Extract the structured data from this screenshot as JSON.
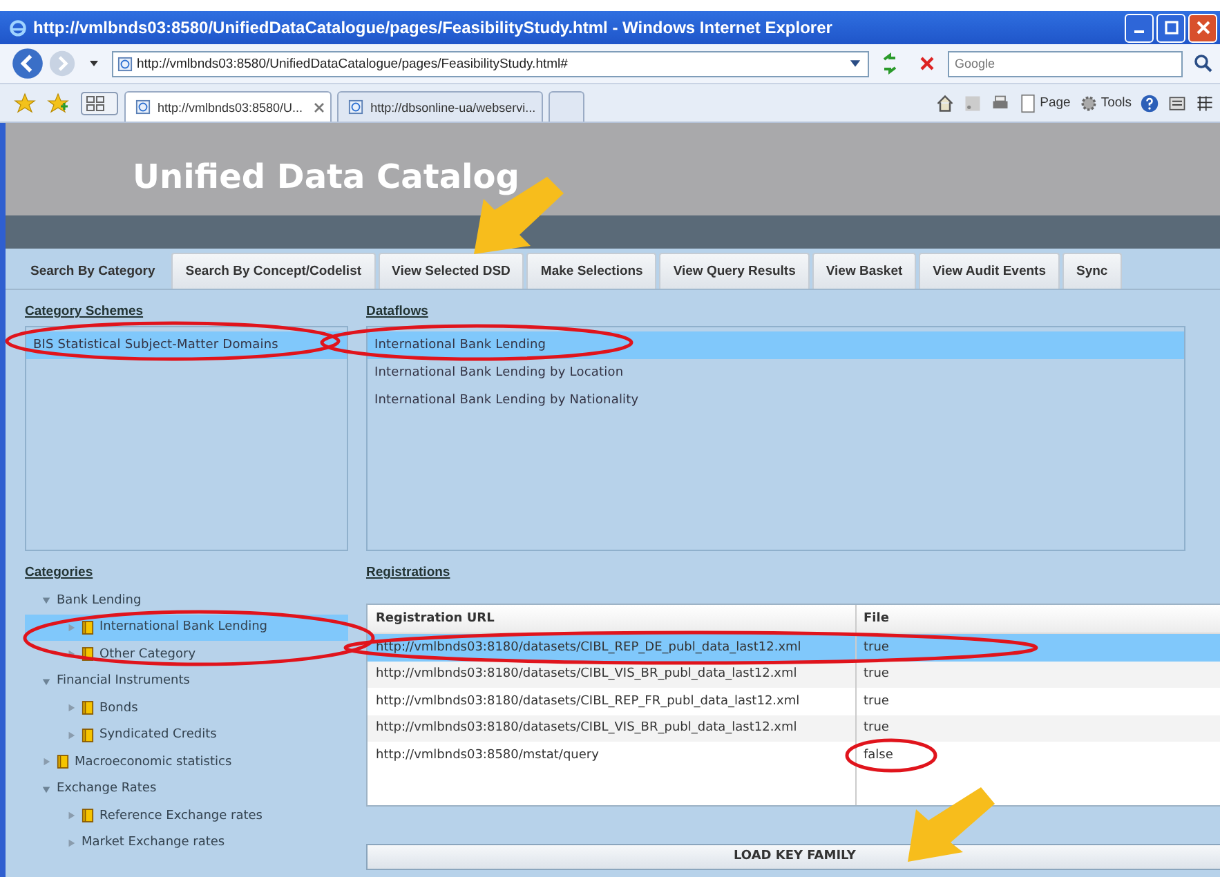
{
  "window": {
    "title": "http://vmlbnds03:8580/UnifiedDataCatalogue/pages/FeasibilityStudy.html - Windows Internet Explorer"
  },
  "address_bar": {
    "value": "http://vmlbnds03:8580/UnifiedDataCatalogue/pages/FeasibilityStudy.html#"
  },
  "search": {
    "placeholder": "Google"
  },
  "browser_tabs": [
    {
      "label": "http://vmlbnds03:8580/U...",
      "selected": true
    },
    {
      "label": "http://dbsonline-ua/webservi...",
      "selected": false
    }
  ],
  "command_bar": [
    "Page",
    "Tools"
  ],
  "page": {
    "title": "Unified Data Catalog"
  },
  "tabs": [
    {
      "label": "Search By Category",
      "selected": true
    },
    {
      "label": "Search By Concept/Codelist",
      "selected": false
    },
    {
      "label": "View Selected DSD",
      "selected": false
    },
    {
      "label": "Make Selections",
      "selected": false
    },
    {
      "label": "View Query Results",
      "selected": false
    },
    {
      "label": "View Basket",
      "selected": false
    },
    {
      "label": "View Audit Events",
      "selected": false
    },
    {
      "label": "Sync",
      "selected": false
    }
  ],
  "category_schemes": {
    "heading": "Category Schemes",
    "items": [
      {
        "label": "BIS Statistical Subject-Matter Domains",
        "selected": true
      }
    ]
  },
  "dataflows": {
    "heading": "Dataflows",
    "items": [
      {
        "label": "International Bank Lending",
        "selected": true
      },
      {
        "label": "International Bank Lending by Location",
        "selected": false
      },
      {
        "label": "International Bank Lending by Nationality",
        "selected": false
      }
    ]
  },
  "categories": {
    "heading": "Categories",
    "tree": [
      {
        "label": "Bank Lending",
        "kind": "plain",
        "expanded": true,
        "selected": false,
        "children": [
          {
            "label": "International Bank Lending",
            "kind": "folder",
            "expanded": false,
            "selected": true
          },
          {
            "label": "Other Category",
            "kind": "folder",
            "expanded": false,
            "selected": false
          }
        ]
      },
      {
        "label": "Financial Instruments",
        "kind": "plain",
        "expanded": true,
        "selected": false,
        "children": [
          {
            "label": "Bonds",
            "kind": "folder",
            "expanded": false,
            "selected": false
          },
          {
            "label": "Syndicated Credits",
            "kind": "folder",
            "expanded": false,
            "selected": false
          }
        ]
      },
      {
        "label": "Macroeconomic statistics",
        "kind": "folder",
        "expanded": false,
        "selected": false
      },
      {
        "label": "Exchange Rates",
        "kind": "plain",
        "expanded": true,
        "selected": false,
        "children": [
          {
            "label": "Reference Exchange rates",
            "kind": "folder",
            "expanded": false,
            "selected": false
          },
          {
            "label": "Market Exchange rates",
            "kind": "plain",
            "expanded": false,
            "selected": false
          }
        ]
      }
    ]
  },
  "registrations": {
    "heading": "Registrations",
    "columns": [
      "Registration URL",
      "File"
    ],
    "rows": [
      {
        "url": "http://vmlbnds03:8180/datasets/CIBL_REP_DE_publ_data_last12.xml",
        "file": "true",
        "selected": true
      },
      {
        "url": "http://vmlbnds03:8180/datasets/CIBL_VIS_BR_publ_data_last12.xml",
        "file": "true",
        "selected": false
      },
      {
        "url": "http://vmlbnds03:8180/datasets/CIBL_REP_FR_publ_data_last12.xml",
        "file": "true",
        "selected": false
      },
      {
        "url": "http://vmlbnds03:8180/datasets/CIBL_VIS_BR_publ_data_last12.xml",
        "file": "true",
        "selected": false
      },
      {
        "url": "http://vmlbnds03:8580/mstat/query",
        "file": "false",
        "selected": false
      }
    ]
  },
  "load_button": {
    "label": "LOAD KEY FAMILY"
  }
}
